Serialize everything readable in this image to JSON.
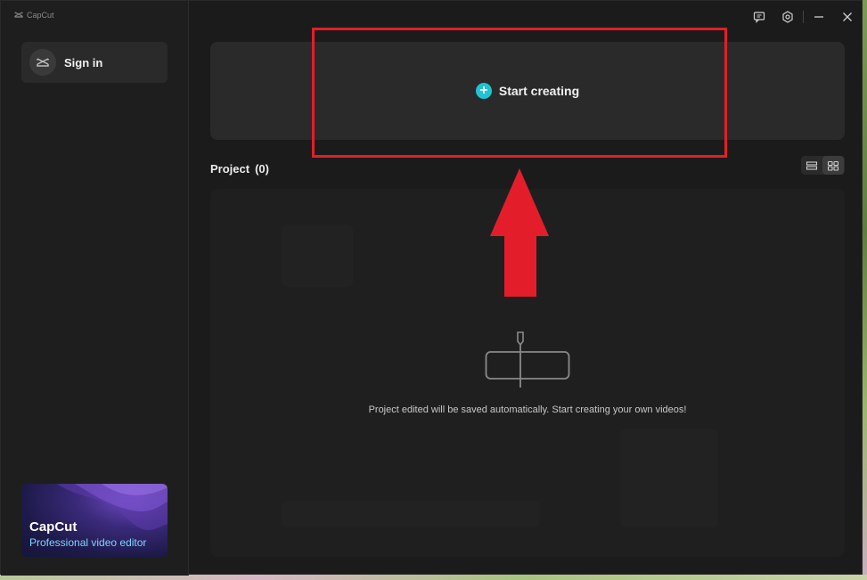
{
  "app": {
    "brand_name": "CapCut"
  },
  "sidebar": {
    "signin_label": "Sign in",
    "promo": {
      "title": "CapCut",
      "subtitle": "Professional video editor"
    }
  },
  "titlebar": {
    "icons": [
      "feedback-icon",
      "settings-icon",
      "minimize-icon",
      "close-icon"
    ]
  },
  "main": {
    "create_label": "Start creating",
    "project_label": "Project",
    "project_count": "(0)",
    "empty_message": "Project edited will be saved automatically. Start creating your own videos!"
  },
  "colors": {
    "accent": "#1fc3d3",
    "annotation_red": "#e31e2a",
    "promo_text": "#7fd4ff",
    "background": "#1b1b1b"
  }
}
